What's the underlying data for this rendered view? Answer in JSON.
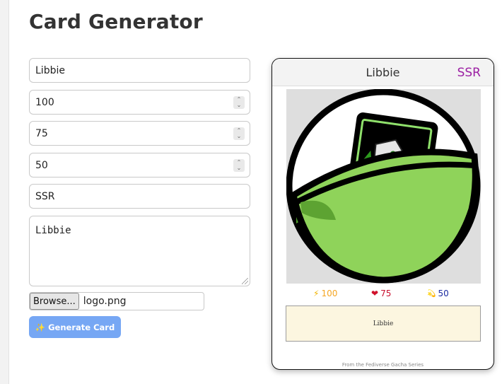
{
  "page": {
    "title": "Card Generator"
  },
  "form": {
    "name_value": "Libbie",
    "power_value": "100",
    "health_value": "75",
    "luck_value": "50",
    "rarity_value": "SSR",
    "description_value": "Libbie",
    "browse_label": "Browse...",
    "file_name": "logo.png",
    "generate_label": "✨ Generate Card",
    "spin_up": "⌃",
    "spin_down": "⌄"
  },
  "card": {
    "name": "Libbie",
    "rarity": "SSR",
    "stats": [
      {
        "icon": "⚡",
        "value": "100",
        "color": "#f5a623"
      },
      {
        "icon": "❤",
        "value": "75",
        "color": "#c8102e"
      },
      {
        "icon": "💫",
        "value": "50",
        "color": "#1a2aa0"
      }
    ],
    "description": "Libbie",
    "footer": "From the Fediverse Gacha Series"
  },
  "colors": {
    "accent_blue": "#76a7f4",
    "rarity_purple": "#9b1fa3",
    "capsule_green": "#8fd35a"
  }
}
